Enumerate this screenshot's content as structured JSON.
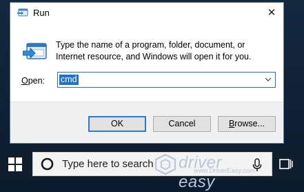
{
  "dialog": {
    "title": "Run",
    "description": "Type the name of a program, folder, document, or Internet resource, and Windows will open it for you.",
    "open_label_accel": "O",
    "open_label_rest": "pen:",
    "open_value": "cmd",
    "ok_label": "OK",
    "cancel_label": "Cancel",
    "browse_label_accel": "B",
    "browse_label_rest": "rowse...",
    "close_glyph": "✕"
  },
  "taskbar": {
    "search_placeholder": "Type here to search",
    "watermark_brand": "driver easy",
    "watermark_url": "www.DriverEasy.com"
  },
  "icons": {
    "title": "run-icon",
    "big": "run-icon",
    "start": "windows-logo-icon",
    "cortana": "cortana-icon",
    "mic": "microphone-icon",
    "task_view": "task-view-icon",
    "dropdown": "chevron-down-icon",
    "close": "close-icon"
  },
  "colors": {
    "accent": "#1e73cf",
    "taskbar": "#101e2e",
    "dialog_footer": "#f0f0f0"
  }
}
